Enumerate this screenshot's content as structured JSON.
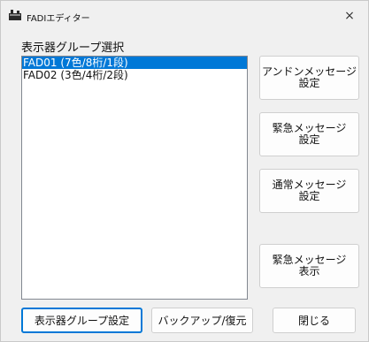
{
  "window": {
    "title": "FADIエディター",
    "close_glyph": "×"
  },
  "group_select": {
    "label": "表示器グループ選択",
    "items": [
      {
        "label": "FAD01 (7色/8桁/1段)",
        "selected": true
      },
      {
        "label": "FAD02 (3色/4桁/2段)",
        "selected": false
      }
    ]
  },
  "side_buttons": {
    "undone_message": "アンドンメッセージ\n設定",
    "emergency_message": "緊急メッセージ\n設定",
    "normal_message": "通常メッセージ\n設定",
    "emergency_display": "緊急メッセージ\n表示"
  },
  "bottom_buttons": {
    "group_settings": "表示器グループ設定",
    "backup_restore": "バックアップ/復元",
    "close": "閉じる"
  },
  "colors": {
    "selection": "#0078d7",
    "background": "#f0f0f0"
  }
}
